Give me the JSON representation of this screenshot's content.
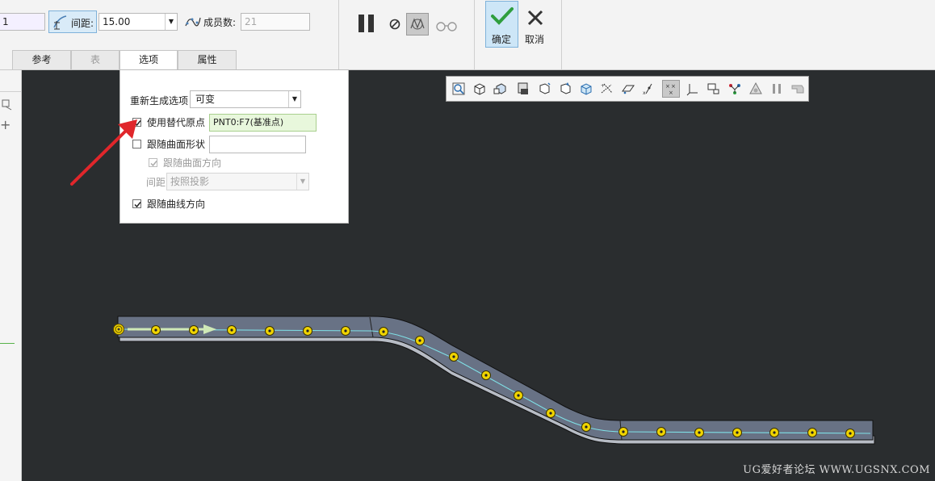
{
  "ribbon": {
    "count_field_value": "1",
    "spacing_label": "间距:",
    "spacing_value": "15.00",
    "members_label": "成员数:",
    "members_value": "21",
    "ok_label": "确定",
    "cancel_label": "取消"
  },
  "tabs": [
    {
      "label": "参考"
    },
    {
      "label": "表"
    },
    {
      "label": "选项"
    },
    {
      "label": "属性"
    }
  ],
  "options_panel": {
    "regen_label": "重新生成选项",
    "regen_value": "可变",
    "use_alt_origin_label": "使用替代原点",
    "use_alt_origin_checked": true,
    "alt_origin_value": "PNT0:F7(基准点)",
    "follow_surface_shape_label": "跟随曲面形状",
    "follow_surface_shape_checked": false,
    "follow_surface_dir_label": "跟随曲面方向",
    "follow_surface_dir_checked": true,
    "spacing_label": "间距",
    "spacing_value": "按照投影",
    "follow_curve_dir_label": "跟随曲线方向",
    "follow_curve_dir_checked": true
  },
  "watermark": "UG爱好者论坛 WWW.UGSNX.COM",
  "colors": {
    "canvas": "#2a2d2f",
    "accent_arrow": "#e0262b",
    "ok_bg": "#cde6f7",
    "alt_origin_bg": "#e8f7dc"
  }
}
